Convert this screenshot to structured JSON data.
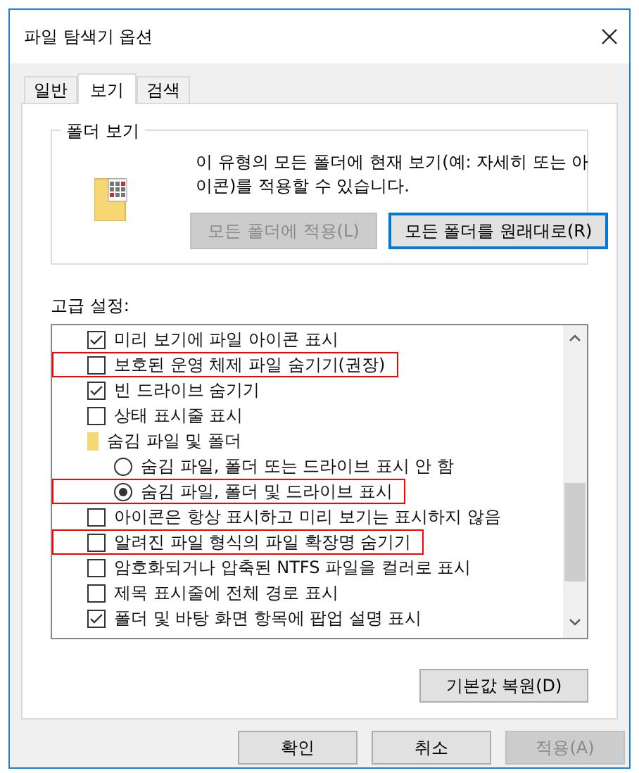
{
  "window": {
    "title": "파일 탐색기 옵션"
  },
  "tabs": [
    {
      "label": "일반",
      "selected": false
    },
    {
      "label": "보기",
      "selected": true
    },
    {
      "label": "검색",
      "selected": false
    }
  ],
  "folder_view": {
    "title": "폴더 보기",
    "description": "이 유형의 모든 폴더에 현재 보기(예: 자세히 또는 아이콘)를 적용할 수 있습니다.",
    "buttons": [
      {
        "label": "모든 폴더에 적용(L)",
        "disabled": true,
        "focused": false
      },
      {
        "label": "모든 폴더를 원래대로(R)",
        "disabled": false,
        "focused": true
      }
    ]
  },
  "advanced": {
    "label": "고급 설정:",
    "items": [
      {
        "kind": "checkbox",
        "label": "미리 보기에 파일 아이콘 표시",
        "checked": true,
        "highlighted": false
      },
      {
        "kind": "checkbox",
        "label": "보호된 운영 체제 파일 숨기기(권장)",
        "checked": false,
        "highlighted": true
      },
      {
        "kind": "checkbox",
        "label": "빈 드라이브 숨기기",
        "checked": true,
        "highlighted": false
      },
      {
        "kind": "checkbox",
        "label": "상태 표시줄 표시",
        "checked": false,
        "highlighted": false
      },
      {
        "kind": "folder",
        "label": "숨김 파일 및 폴더",
        "highlighted": false,
        "children": [
          {
            "kind": "radio",
            "label": "숨김 파일, 폴더 또는 드라이브 표시 안 함",
            "selected": false,
            "highlighted": false
          },
          {
            "kind": "radio",
            "label": "숨김 파일, 폴더 및 드라이브 표시",
            "selected": true,
            "highlighted": true
          }
        ]
      },
      {
        "kind": "checkbox",
        "label": "아이콘은 항상 표시하고 미리 보기는 표시하지 않음",
        "checked": false,
        "highlighted": false
      },
      {
        "kind": "checkbox",
        "label": "알려진 파일 형식의 파일 확장명 숨기기",
        "checked": false,
        "highlighted": true
      },
      {
        "kind": "checkbox",
        "label": "암호화되거나 압축된 NTFS 파일을 컬러로 표시",
        "checked": false,
        "highlighted": false
      },
      {
        "kind": "checkbox",
        "label": "제목 표시줄에 전체 경로 표시",
        "checked": false,
        "highlighted": false
      },
      {
        "kind": "checkbox",
        "label": "폴더 및 바탕 화면 항목에 팝업 설명 표시",
        "checked": true,
        "highlighted": false
      }
    ],
    "restore_button": {
      "label": "기본값 복원(D)"
    }
  },
  "footer_buttons": [
    {
      "label": "확인",
      "disabled": false
    },
    {
      "label": "취소",
      "disabled": false
    },
    {
      "label": "적용(A)",
      "disabled": true
    }
  ]
}
